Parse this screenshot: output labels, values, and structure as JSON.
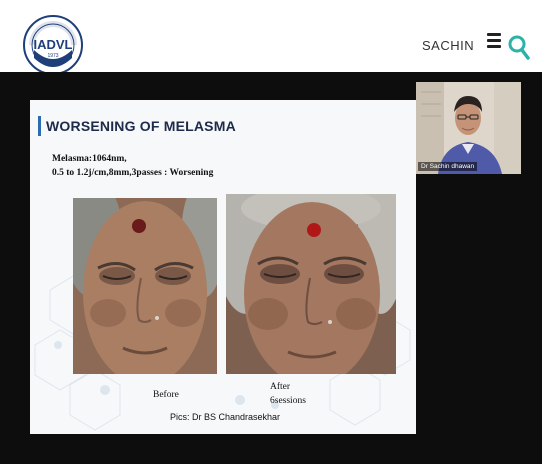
{
  "header": {
    "logo_text": "IADVL",
    "logo_year": "1973",
    "logo_ring_text": "INDIAN ASSOCIATION OF DERMATOLOGISTS, VENEREOLOGISTS & LEPROLOGISTS",
    "user_name": "SACHIN",
    "menu_icon": "hamburger-menu-icon",
    "search_icon": "search-icon",
    "accent_color": "#2bb3a8"
  },
  "slide": {
    "title": "WORSENING OF MELASMA",
    "line1": "Melasma:1064nm,",
    "line2": "0.5 to 1.2j/cm,8mm,3passes : Worsening",
    "before_caption": "Before",
    "after_caption_1": "After",
    "after_caption_2": "6sessions",
    "credit": "Pics: Dr BS Chandrasekhar"
  },
  "camera": {
    "presenter_label": "Dr Sachin dhawan"
  }
}
